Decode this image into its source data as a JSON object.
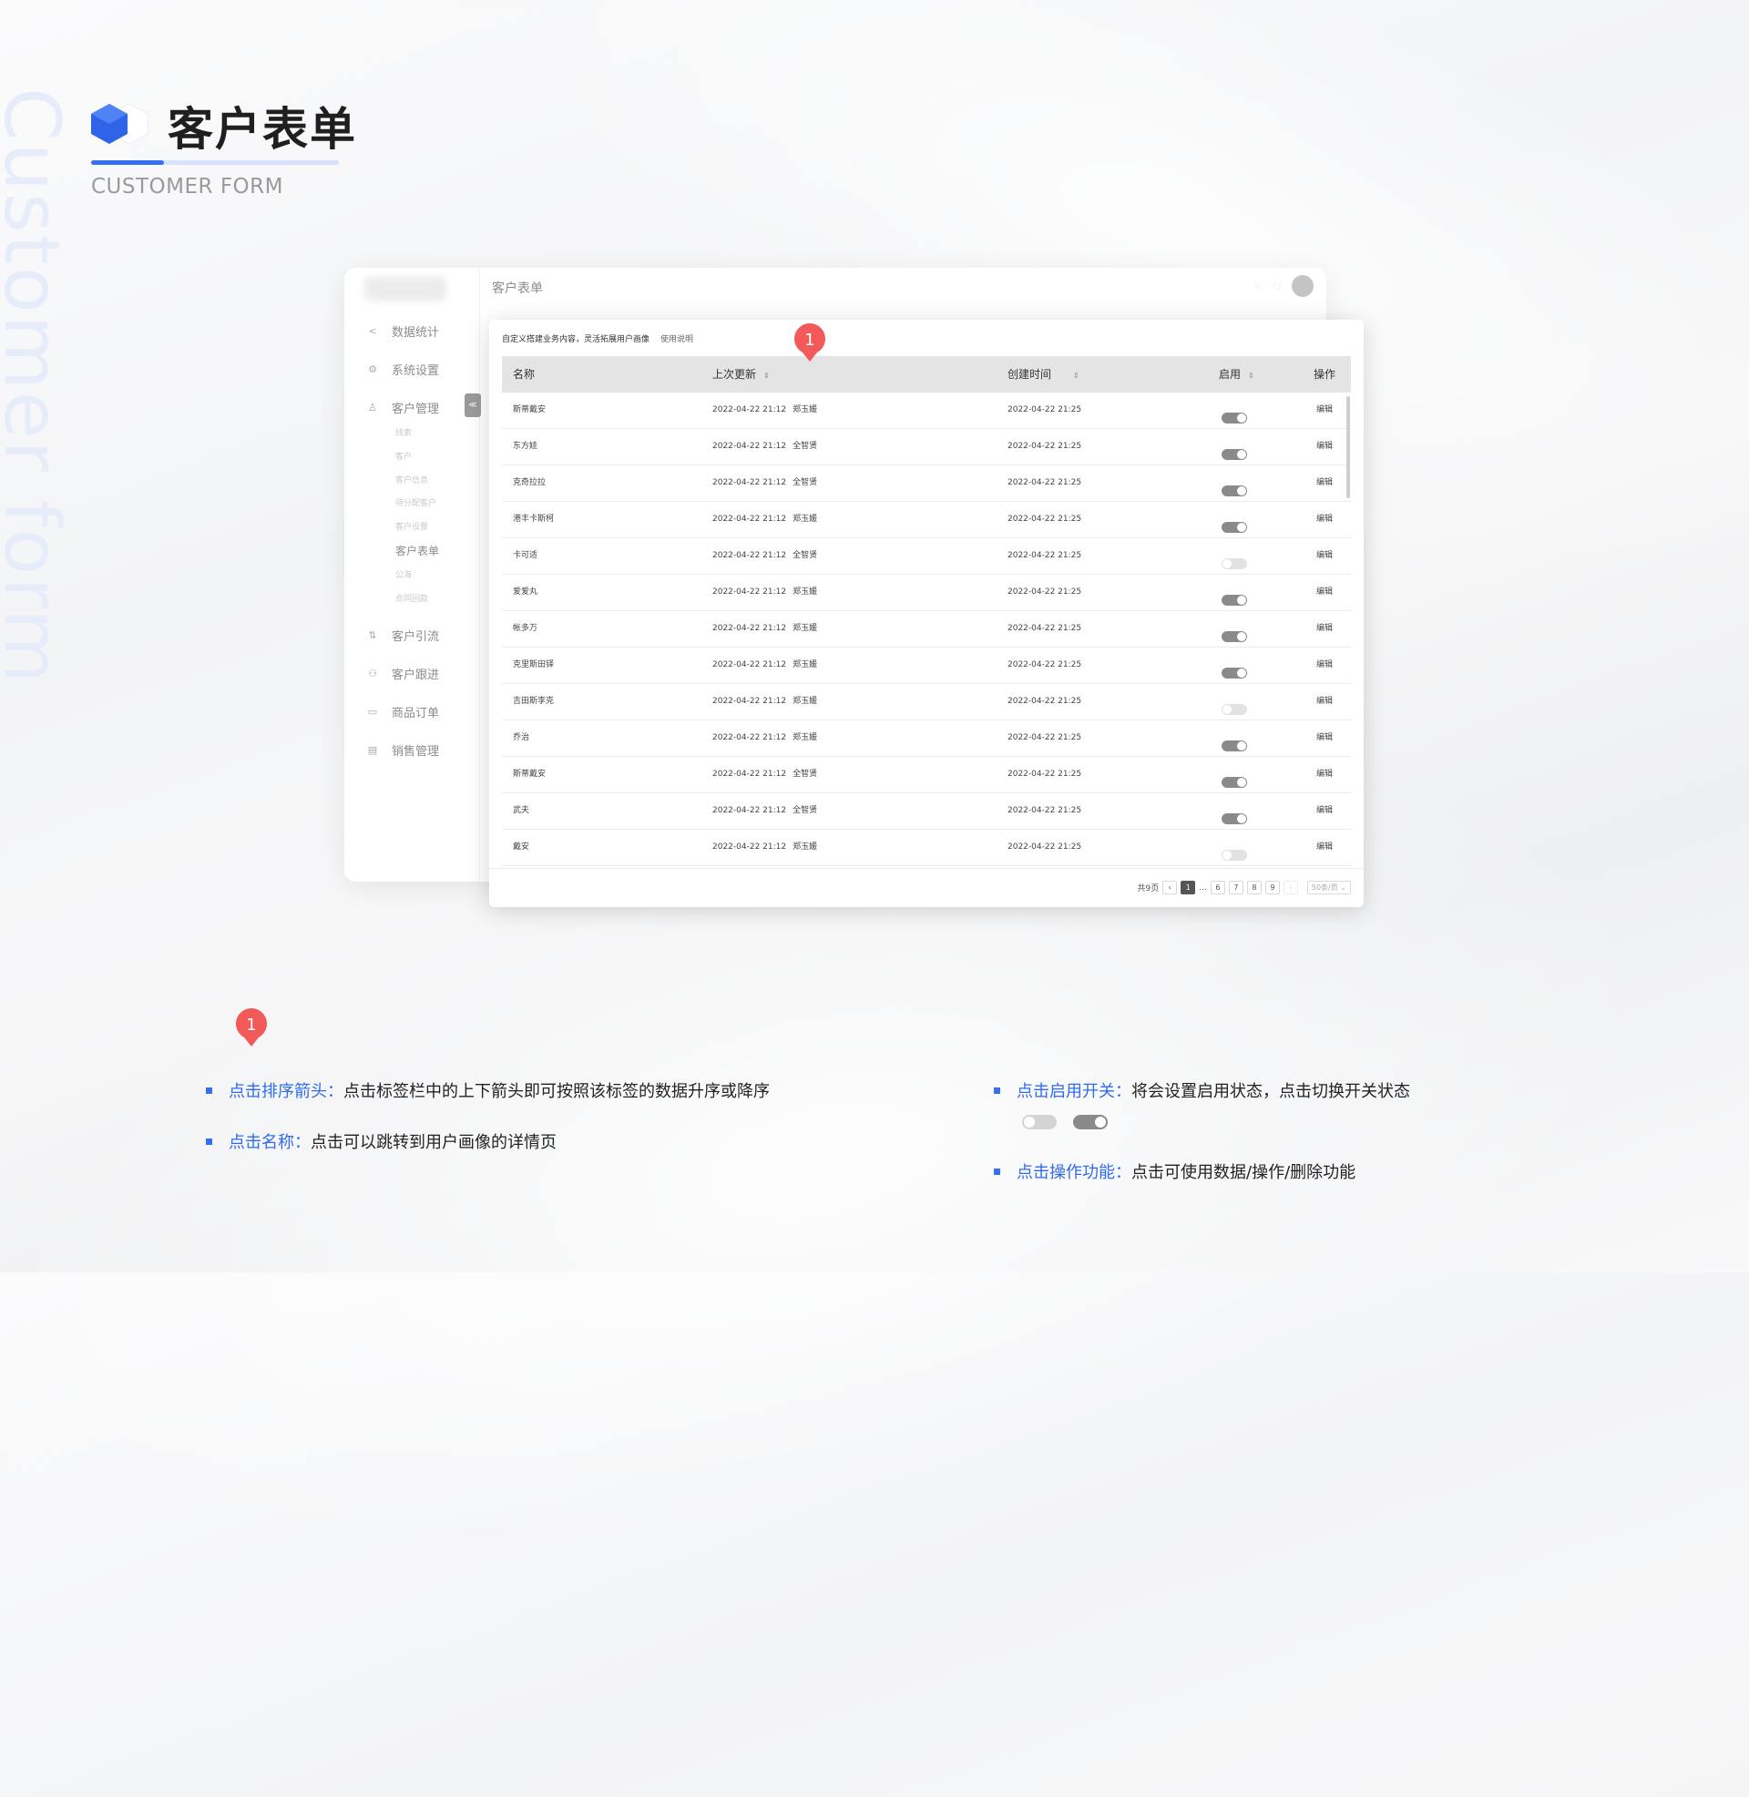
{
  "watermark": "Customer form",
  "header": {
    "title": "客户表单",
    "subtitle": "CUSTOMER FORM",
    "accent_color": "#3570f0"
  },
  "back_window": {
    "page_title": "客户表单",
    "sidebar": {
      "items": [
        {
          "label": "数据统计",
          "icon": "chevron-left-icon"
        },
        {
          "label": "系统设置",
          "icon": "gear-icon"
        },
        {
          "label": "客户管理",
          "icon": "user-icon"
        },
        {
          "label": "客户引流",
          "icon": "flow-icon"
        },
        {
          "label": "客户跟进",
          "icon": "group-icon"
        },
        {
          "label": "商品订单",
          "icon": "order-icon"
        },
        {
          "label": "销售管理",
          "icon": "sales-icon"
        }
      ],
      "sub_items": [
        "线索",
        "客户",
        "客户信息",
        "待分配客户",
        "客户设置",
        "客户表单",
        "公海",
        "合同回款"
      ],
      "collapse_label": "≪"
    }
  },
  "card": {
    "description": "自定义搭建业务内容，灵活拓展用户画像",
    "help_link": "使用说明",
    "columns": {
      "name": "名称",
      "updated": "上次更新",
      "created": "创建时间",
      "enabled": "启用",
      "action": "操作"
    },
    "rows": [
      {
        "name": "斯蒂戴安",
        "updated": "2022-04-22 21:12",
        "who": "郑玉媛",
        "created": "2022-04-22 21:25",
        "enabled": true,
        "action": "编辑"
      },
      {
        "name": "东方娃",
        "updated": "2022-04-22 21:12",
        "who": "全智贤",
        "created": "2022-04-22 21:25",
        "enabled": true,
        "action": "编辑"
      },
      {
        "name": "克奇拉拉",
        "updated": "2022-04-22 21:12",
        "who": "全智贤",
        "created": "2022-04-22 21:25",
        "enabled": true,
        "action": "编辑"
      },
      {
        "name": "港丰卡斯柯",
        "updated": "2022-04-22 21:12",
        "who": "郑玉媛",
        "created": "2022-04-22 21:25",
        "enabled": true,
        "action": "编辑"
      },
      {
        "name": "卡可适",
        "updated": "2022-04-22 21:12",
        "who": "全智贤",
        "created": "2022-04-22 21:25",
        "enabled": false,
        "action": "编辑"
      },
      {
        "name": "爱爱丸",
        "updated": "2022-04-22 21:12",
        "who": "郑玉媛",
        "created": "2022-04-22 21:25",
        "enabled": true,
        "action": "编辑"
      },
      {
        "name": "帐多万",
        "updated": "2022-04-22 21:12",
        "who": "郑玉媛",
        "created": "2022-04-22 21:25",
        "enabled": true,
        "action": "编辑"
      },
      {
        "name": "克里斯田铎",
        "updated": "2022-04-22 21:12",
        "who": "郑玉媛",
        "created": "2022-04-22 21:25",
        "enabled": true,
        "action": "编辑"
      },
      {
        "name": "吉田斯李克",
        "updated": "2022-04-22 21:12",
        "who": "郑玉媛",
        "created": "2022-04-22 21:25",
        "enabled": false,
        "action": "编辑"
      },
      {
        "name": "乔治",
        "updated": "2022-04-22 21:12",
        "who": "郑玉媛",
        "created": "2022-04-22 21:25",
        "enabled": true,
        "action": "编辑"
      },
      {
        "name": "斯蒂戴安",
        "updated": "2022-04-22 21:12",
        "who": "全智贤",
        "created": "2022-04-22 21:25",
        "enabled": true,
        "action": "编辑"
      },
      {
        "name": "武夫",
        "updated": "2022-04-22 21:12",
        "who": "全智贤",
        "created": "2022-04-22 21:25",
        "enabled": true,
        "action": "编辑"
      },
      {
        "name": "戴安",
        "updated": "2022-04-22 21:12",
        "who": "郑玉媛",
        "created": "2022-04-22 21:25",
        "enabled": false,
        "action": "编辑"
      }
    ],
    "pagination": {
      "total": "共9页",
      "prev": "‹",
      "pages": [
        "1",
        "...",
        "6",
        "7",
        "8",
        "9"
      ],
      "current": "1",
      "next": "›",
      "page_size": "50条/页"
    }
  },
  "markers": {
    "pin1": "1",
    "pin2": "1",
    "pin_color": "#f25a5a"
  },
  "notes": {
    "left": [
      {
        "highlight": "点击排序箭头：",
        "text": "点击标签栏中的上下箭头即可按照该标签的数据升序或降序"
      },
      {
        "highlight": "点击名称：",
        "text": "点击可以跳转到用户画像的详情页"
      }
    ],
    "right": [
      {
        "highlight": "点击启用开关：",
        "text": "将会设置启用状态，点击切换开关状态"
      },
      {
        "highlight": "点击操作功能：",
        "text": "点击可使用数据/操作/删除功能"
      }
    ]
  }
}
